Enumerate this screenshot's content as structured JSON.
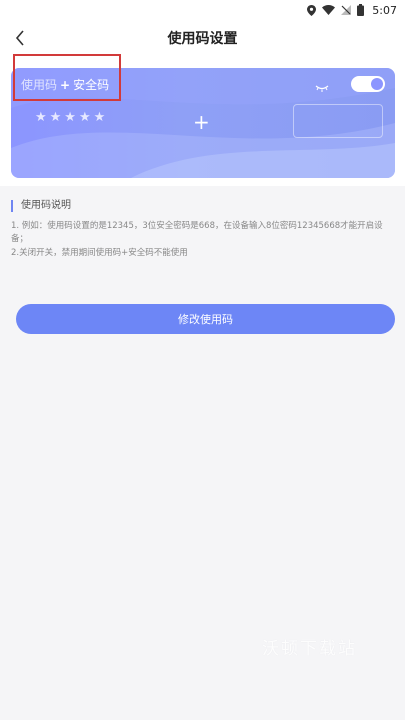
{
  "status_bar": {
    "time": "5:07"
  },
  "nav": {
    "title": "使用码设置"
  },
  "card": {
    "label_use_code": "使用码",
    "label_plus": "+",
    "label_security_code": "安全码",
    "stars": "★★★★★",
    "plus_sign": "+",
    "toggle_on": true,
    "accent_color": "#8c95ff"
  },
  "section": {
    "title": "使用码说明",
    "line1": "1. 例如：使用码设置的是12345，3位安全密码是668，在设备输入8位密码12345668才能开启设备；",
    "line2": "2.关闭开关，禁用期间使用码+安全码不能使用"
  },
  "button": {
    "label": "修改使用码",
    "color": "#6d86f6"
  },
  "watermark": "沃顿下载站"
}
